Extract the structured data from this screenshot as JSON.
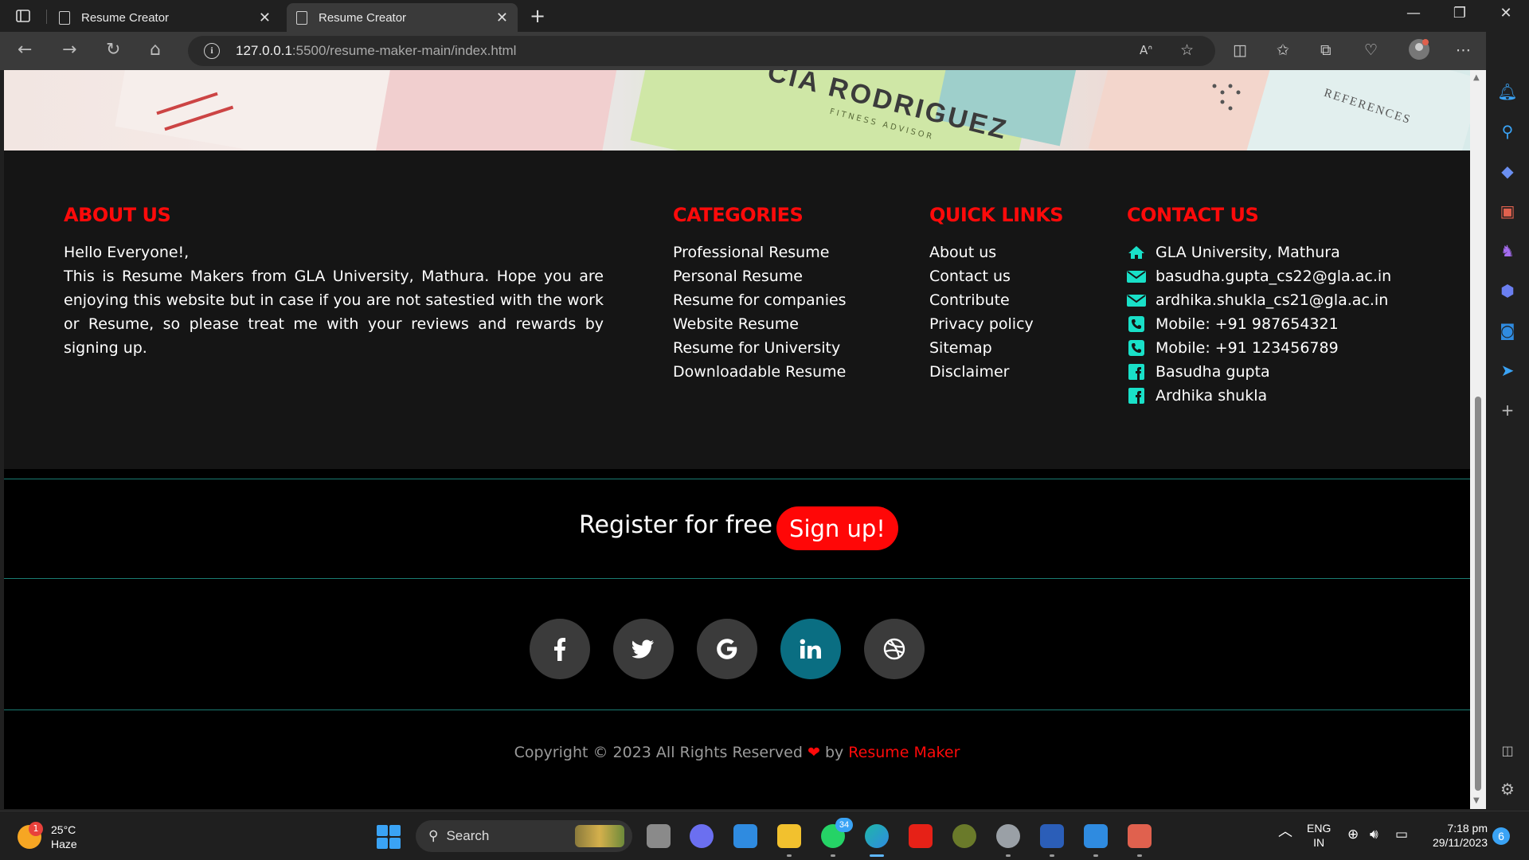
{
  "browser": {
    "tabs": [
      {
        "title": "Resume Creator",
        "active": false
      },
      {
        "title": "Resume Creator",
        "active": true
      }
    ],
    "url_host": "127.0.0.1",
    "url_rest": ":5500/resume-maker-main/index.html"
  },
  "hero": {
    "name": "CIA RODRIGUEZ",
    "subtitle": "FITNESS ADVISOR",
    "references": "REFERENCES"
  },
  "footer": {
    "about": {
      "title": "ABOUT US",
      "greeting": "Hello Everyone!,",
      "text": "This is Resume Makers from GLA University, Mathura. Hope you are enjoying this website but in case if you are not satestied with the work or Resume, so please treat me with your reviews and rewards by signing up."
    },
    "categories": {
      "title": "CATEGORIES",
      "items": [
        "Professional Resume",
        "Personal Resume",
        "Resume for companies",
        "Website Resume",
        "Resume for University",
        "Downloadable Resume"
      ]
    },
    "quick_links": {
      "title": "QUICK LINKS",
      "items": [
        "About us",
        "Contact us",
        "Contribute",
        "Privacy policy",
        "Sitemap",
        "Disclaimer"
      ]
    },
    "contact": {
      "title": "CONTACT US",
      "items": [
        {
          "icon": "home-icon",
          "text": "GLA University, Mathura"
        },
        {
          "icon": "envelope-icon",
          "text": "basudha.gupta_cs22@gla.ac.in"
        },
        {
          "icon": "envelope-icon",
          "text": "ardhika.shukla_cs21@gla.ac.in"
        },
        {
          "icon": "phone-icon",
          "text": "Mobile: +91 987654321"
        },
        {
          "icon": "phone-icon",
          "text": "Mobile: +91 123456789"
        },
        {
          "icon": "facebook-square-icon",
          "text": "Basudha gupta"
        },
        {
          "icon": "facebook-square-icon",
          "text": "Ardhika shukla"
        }
      ]
    },
    "register": {
      "text": "Register for free",
      "button": "Sign up!"
    },
    "social": [
      "facebook-icon",
      "twitter-icon",
      "google-icon",
      "linkedin-icon",
      "dribbble-icon"
    ],
    "copyright": {
      "prefix": "Copyright © 2023 All Rights Reserved",
      "by": "by",
      "brand": "Resume Maker"
    }
  },
  "taskbar": {
    "weather_temp": "25°C",
    "weather_desc": "Haze",
    "weather_badge": "1",
    "search": "Search",
    "whatsapp_badge": "34",
    "lang1": "ENG",
    "lang2": "IN",
    "time": "7:18 pm",
    "date": "29/11/2023",
    "notif": "6"
  },
  "colors": {
    "accent_red": "#ff0a0a",
    "teal": "#19e0c8",
    "linkedin": "#0a6e82"
  }
}
